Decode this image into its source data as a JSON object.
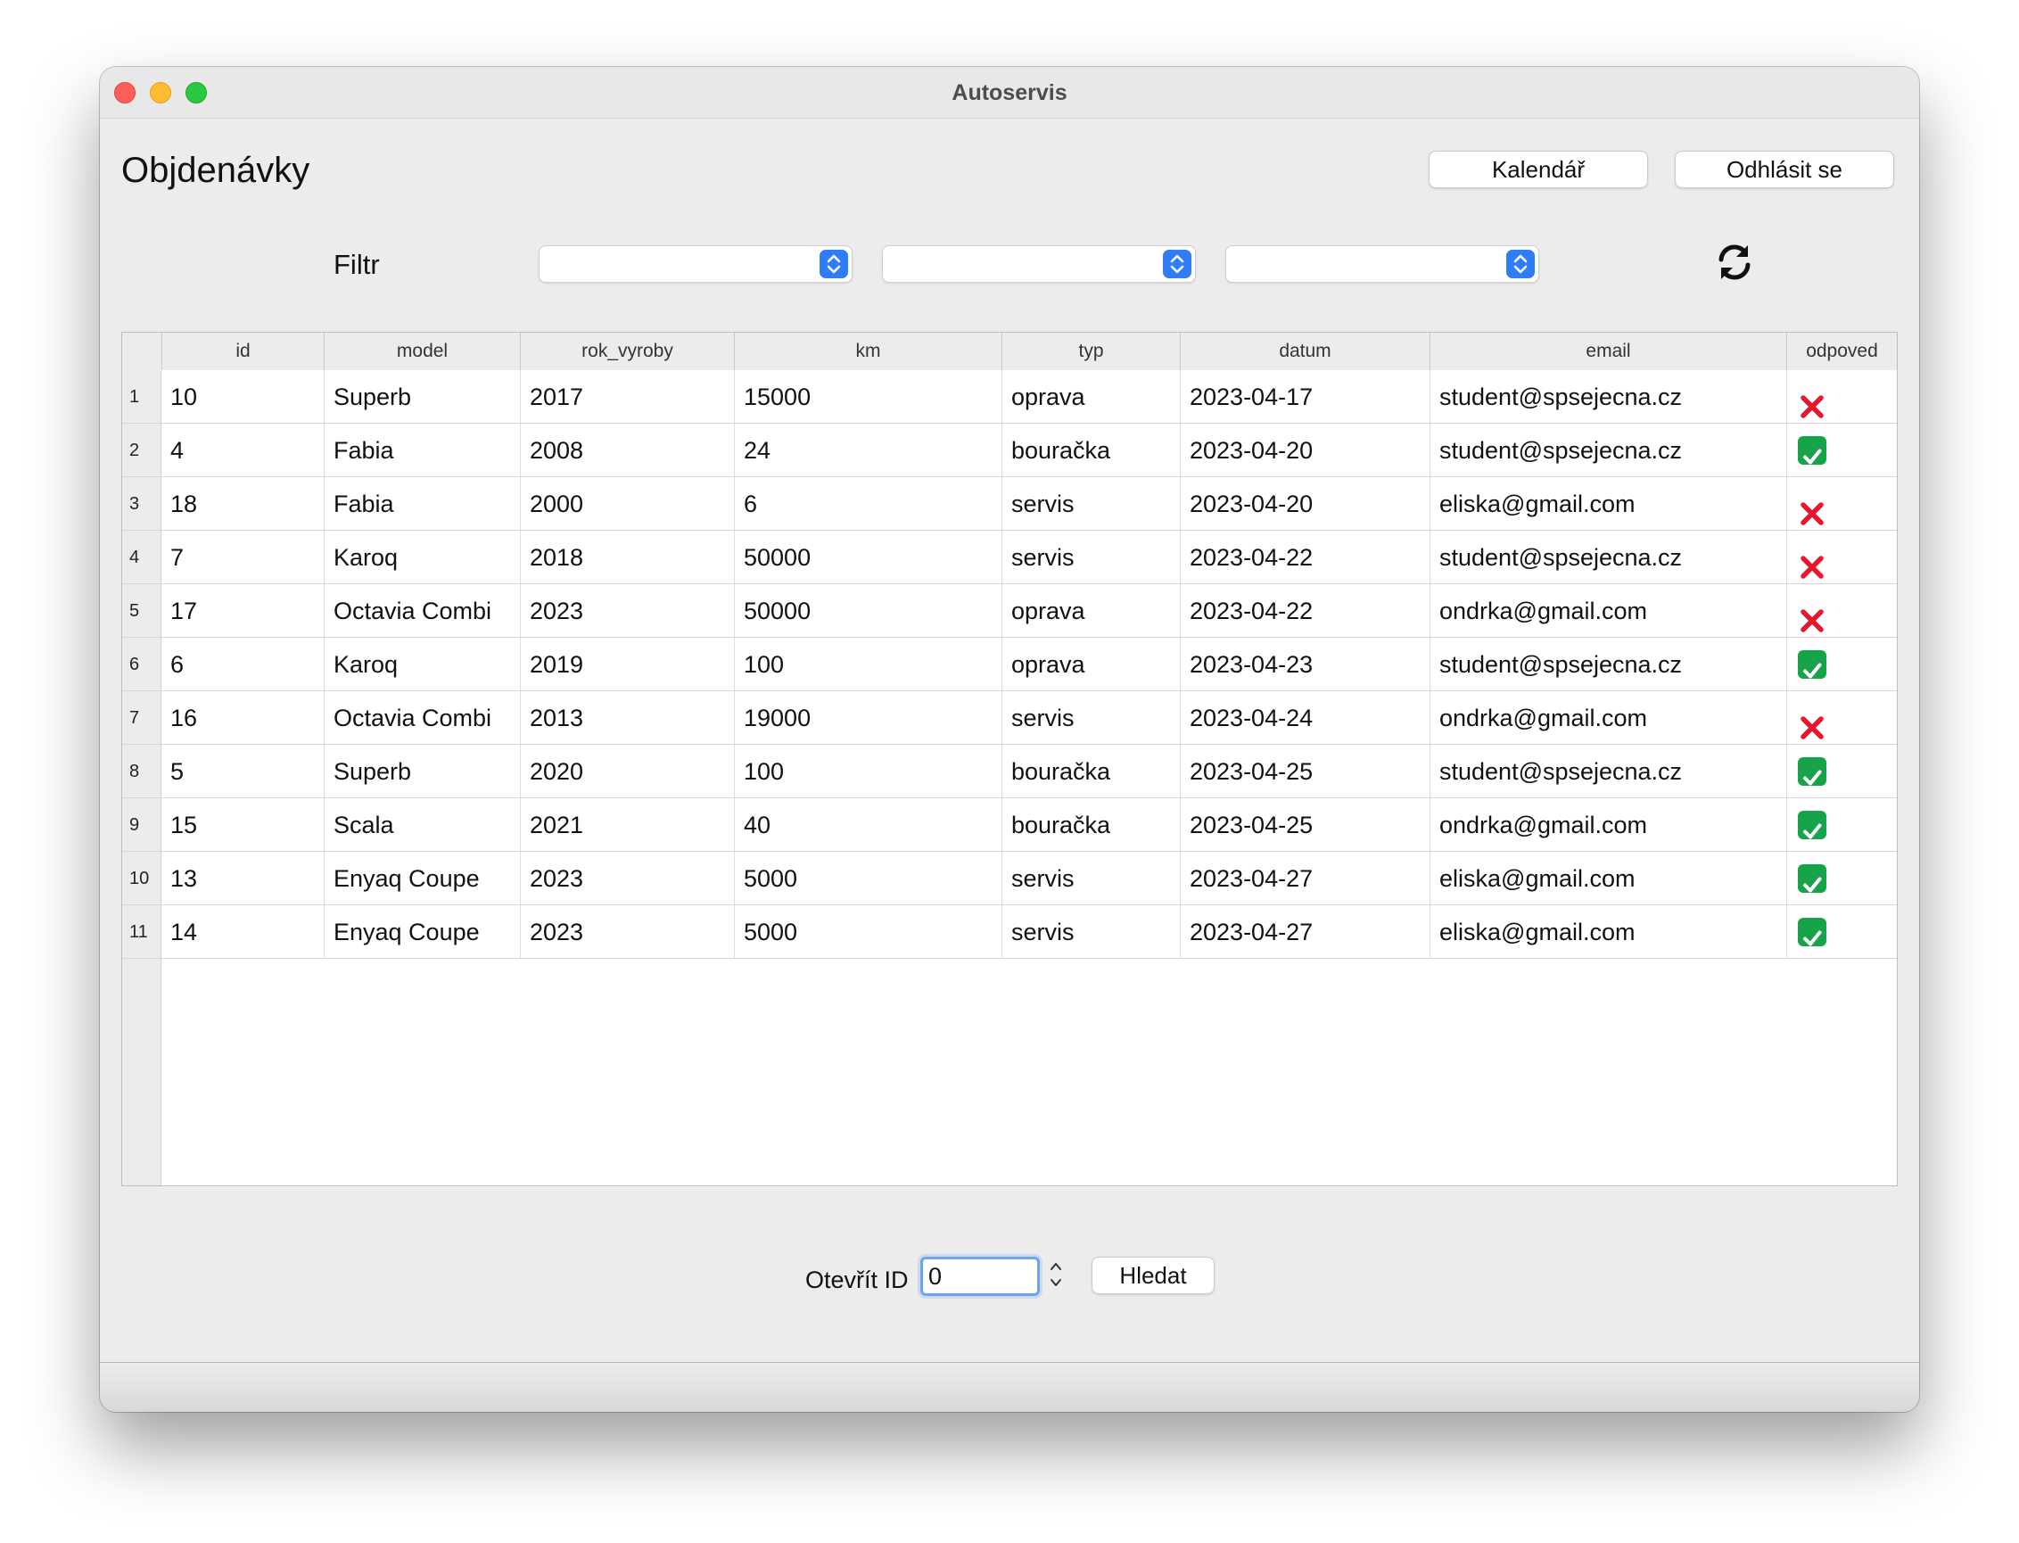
{
  "window": {
    "title": "Autoservis"
  },
  "page_title": "Objdenávky",
  "toolbar": {
    "calendar_label": "Kalendář",
    "logout_label": "Odhlásit se"
  },
  "filter": {
    "label": "Filtr",
    "selects": [
      "",
      "",
      ""
    ]
  },
  "table": {
    "columns": [
      "id",
      "model",
      "rok_vyroby",
      "km",
      "typ",
      "datum",
      "email",
      "odpoved"
    ],
    "rows": [
      {
        "num": "1",
        "id": "10",
        "model": "Superb",
        "rok_vyroby": "2017",
        "km": "15000",
        "typ": "oprava",
        "datum": "2023-04-17",
        "email": "student@spsejecna.cz",
        "odpoved": false
      },
      {
        "num": "2",
        "id": "4",
        "model": "Fabia",
        "rok_vyroby": "2008",
        "km": "24",
        "typ": "bouračka",
        "datum": "2023-04-20",
        "email": "student@spsejecna.cz",
        "odpoved": true
      },
      {
        "num": "3",
        "id": "18",
        "model": "Fabia",
        "rok_vyroby": "2000",
        "km": "6",
        "typ": "servis",
        "datum": "2023-04-20",
        "email": "eliska@gmail.com",
        "odpoved": false
      },
      {
        "num": "4",
        "id": "7",
        "model": "Karoq",
        "rok_vyroby": "2018",
        "km": "50000",
        "typ": "servis",
        "datum": "2023-04-22",
        "email": "student@spsejecna.cz",
        "odpoved": false
      },
      {
        "num": "5",
        "id": "17",
        "model": "Octavia Combi",
        "rok_vyroby": "2023",
        "km": "50000",
        "typ": "oprava",
        "datum": "2023-04-22",
        "email": "ondrka@gmail.com",
        "odpoved": false
      },
      {
        "num": "6",
        "id": "6",
        "model": "Karoq",
        "rok_vyroby": "2019",
        "km": "100",
        "typ": "oprava",
        "datum": "2023-04-23",
        "email": "student@spsejecna.cz",
        "odpoved": true
      },
      {
        "num": "7",
        "id": "16",
        "model": "Octavia Combi",
        "rok_vyroby": "2013",
        "km": "19000",
        "typ": "servis",
        "datum": "2023-04-24",
        "email": "ondrka@gmail.com",
        "odpoved": false
      },
      {
        "num": "8",
        "id": "5",
        "model": "Superb",
        "rok_vyroby": "2020",
        "km": "100",
        "typ": "bouračka",
        "datum": "2023-04-25",
        "email": "student@spsejecna.cz",
        "odpoved": true
      },
      {
        "num": "9",
        "id": "15",
        "model": "Scala",
        "rok_vyroby": "2021",
        "km": "40",
        "typ": "bouračka",
        "datum": "2023-04-25",
        "email": "ondrka@gmail.com",
        "odpoved": true
      },
      {
        "num": "10",
        "id": "13",
        "model": "Enyaq Coupe",
        "rok_vyroby": "2023",
        "km": "5000",
        "typ": "servis",
        "datum": "2023-04-27",
        "email": "eliska@gmail.com",
        "odpoved": true
      },
      {
        "num": "11",
        "id": "14",
        "model": "Enyaq Coupe",
        "rok_vyroby": "2023",
        "km": "5000",
        "typ": "servis",
        "datum": "2023-04-27",
        "email": "eliska@gmail.com",
        "odpoved": true
      }
    ]
  },
  "open": {
    "label": "Otevřít ID",
    "value": "0",
    "search_label": "Hledat"
  },
  "colors": {
    "accent": "#2f7df6",
    "cross": "#e5172c",
    "check": "#16a34a"
  },
  "icons": {
    "refresh": "refresh-icon",
    "yes": "check-icon",
    "no": "cross-icon"
  }
}
